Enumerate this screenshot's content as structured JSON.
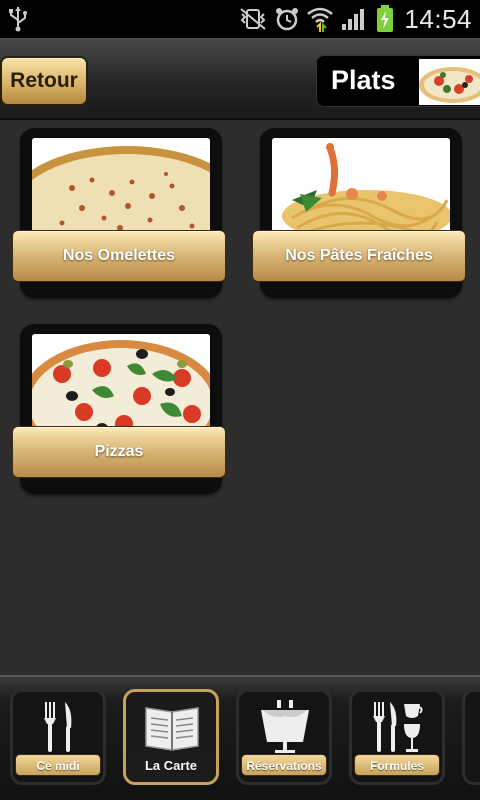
{
  "status_bar": {
    "time": "14:54",
    "icons": [
      "usb-icon",
      "vibrate-off-icon",
      "alarm-icon",
      "wifi-icon",
      "signal-icon",
      "battery-charging-icon"
    ]
  },
  "header": {
    "back_label": "Retour",
    "title": "Plats",
    "title_thumb": "pizza-thumbnail"
  },
  "categories": [
    {
      "label": "Nos Omelettes",
      "image": "omelette-photo"
    },
    {
      "label": "Nos Pâtes Fraîches",
      "image": "pasta-photo"
    },
    {
      "label": "Pizzas",
      "image": "pizza-photo"
    }
  ],
  "tabs": [
    {
      "label": "Ce midi",
      "icon": "cutlery-icon",
      "active": false
    },
    {
      "label": "La Carte",
      "icon": "menu-book-icon",
      "active": true
    },
    {
      "label": "Réservations",
      "icon": "reserved-table-icon",
      "active": false
    },
    {
      "label": "Formules",
      "icon": "cutlery-drinks-icon",
      "active": false
    }
  ],
  "colors": {
    "accent_gold": "#d9b56b",
    "background": "#2d2d2d",
    "header_dark": "#1a1a1a"
  }
}
